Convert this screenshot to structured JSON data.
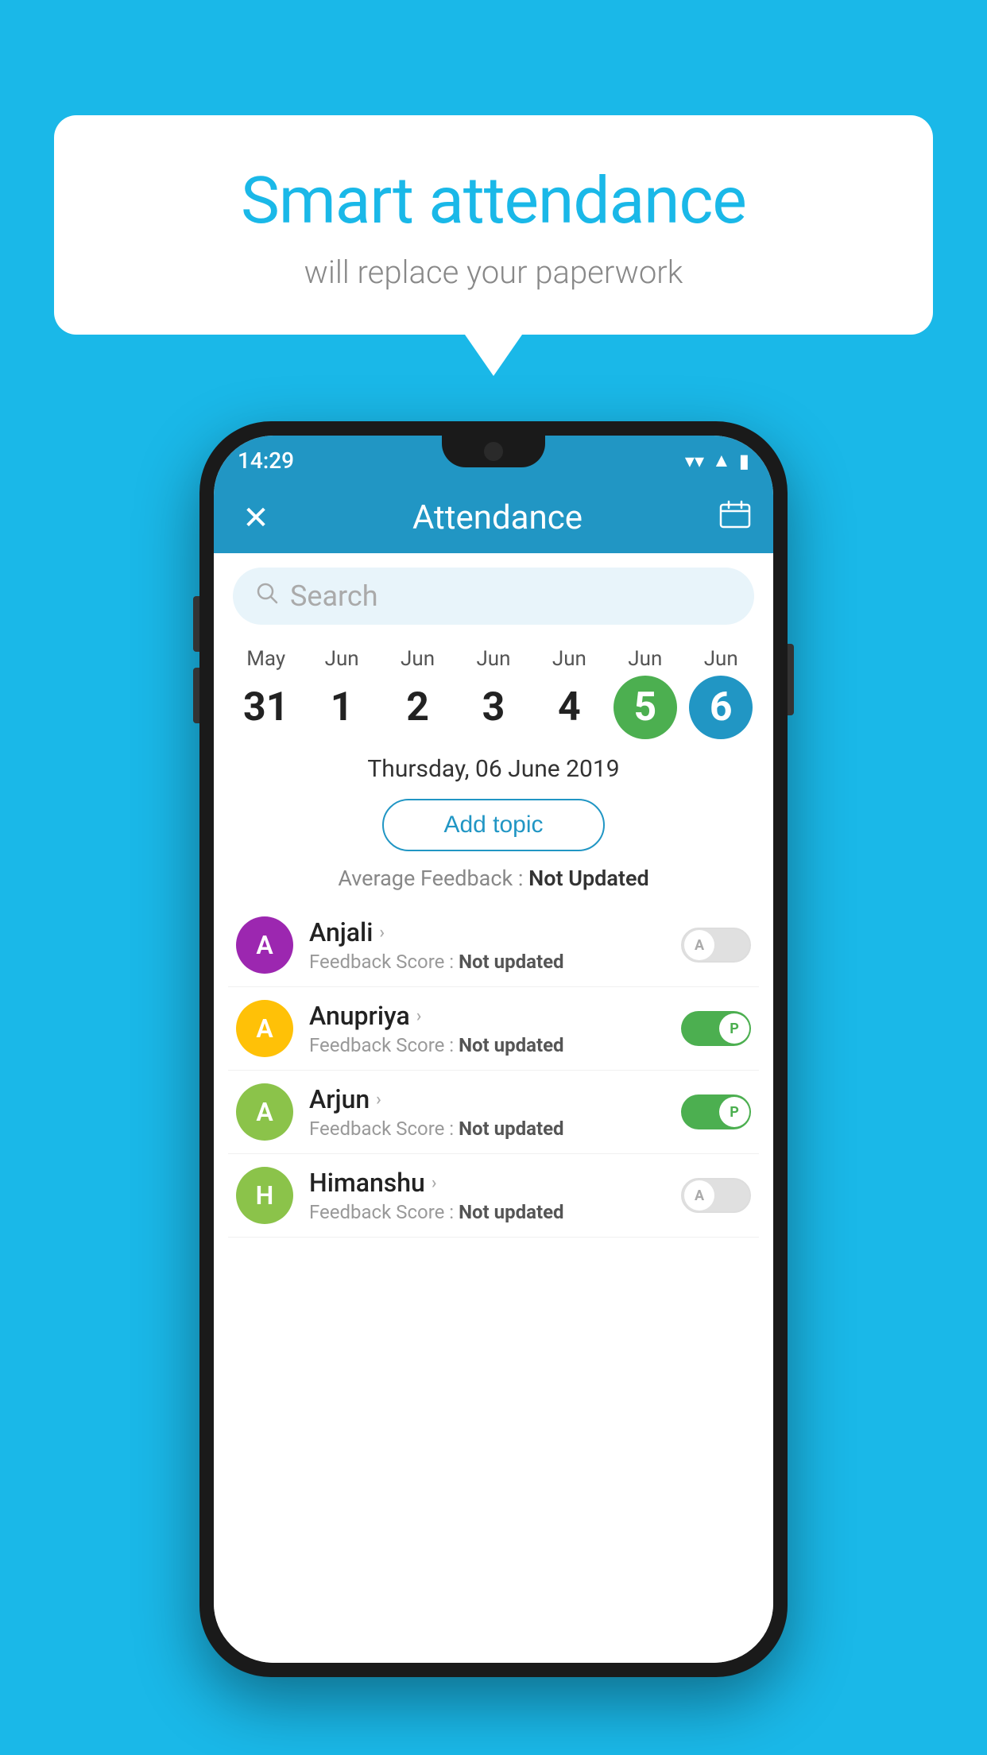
{
  "background_color": "#1ab8e8",
  "bubble": {
    "title": "Smart attendance",
    "subtitle": "will replace your paperwork"
  },
  "status_bar": {
    "time": "14:29",
    "wifi_icon": "▼",
    "signal_icon": "▲",
    "battery_icon": "▮"
  },
  "header": {
    "close_label": "✕",
    "title": "Attendance",
    "calendar_icon": "📅"
  },
  "search": {
    "placeholder": "Search"
  },
  "dates": [
    {
      "month": "May",
      "day": "31",
      "state": "normal"
    },
    {
      "month": "Jun",
      "day": "1",
      "state": "normal"
    },
    {
      "month": "Jun",
      "day": "2",
      "state": "normal"
    },
    {
      "month": "Jun",
      "day": "3",
      "state": "normal"
    },
    {
      "month": "Jun",
      "day": "4",
      "state": "normal"
    },
    {
      "month": "Jun",
      "day": "5",
      "state": "today"
    },
    {
      "month": "Jun",
      "day": "6",
      "state": "selected"
    }
  ],
  "selected_date_label": "Thursday, 06 June 2019",
  "add_topic_label": "Add topic",
  "avg_feedback": {
    "label": "Average Feedback : ",
    "value": "Not Updated"
  },
  "students": [
    {
      "name": "Anjali",
      "avatar_letter": "A",
      "avatar_color": "#9c27b0",
      "feedback_label": "Feedback Score : ",
      "feedback_value": "Not updated",
      "toggle_state": "off",
      "toggle_label": "A"
    },
    {
      "name": "Anupriya",
      "avatar_letter": "A",
      "avatar_color": "#ffc107",
      "feedback_label": "Feedback Score : ",
      "feedback_value": "Not updated",
      "toggle_state": "on",
      "toggle_label": "P"
    },
    {
      "name": "Arjun",
      "avatar_letter": "A",
      "avatar_color": "#8bc34a",
      "feedback_label": "Feedback Score : ",
      "feedback_value": "Not updated",
      "toggle_state": "on",
      "toggle_label": "P"
    },
    {
      "name": "Himanshu",
      "avatar_letter": "H",
      "avatar_color": "#8bc34a",
      "feedback_label": "Feedback Score : ",
      "feedback_value": "Not updated",
      "toggle_state": "off",
      "toggle_label": "A"
    }
  ]
}
